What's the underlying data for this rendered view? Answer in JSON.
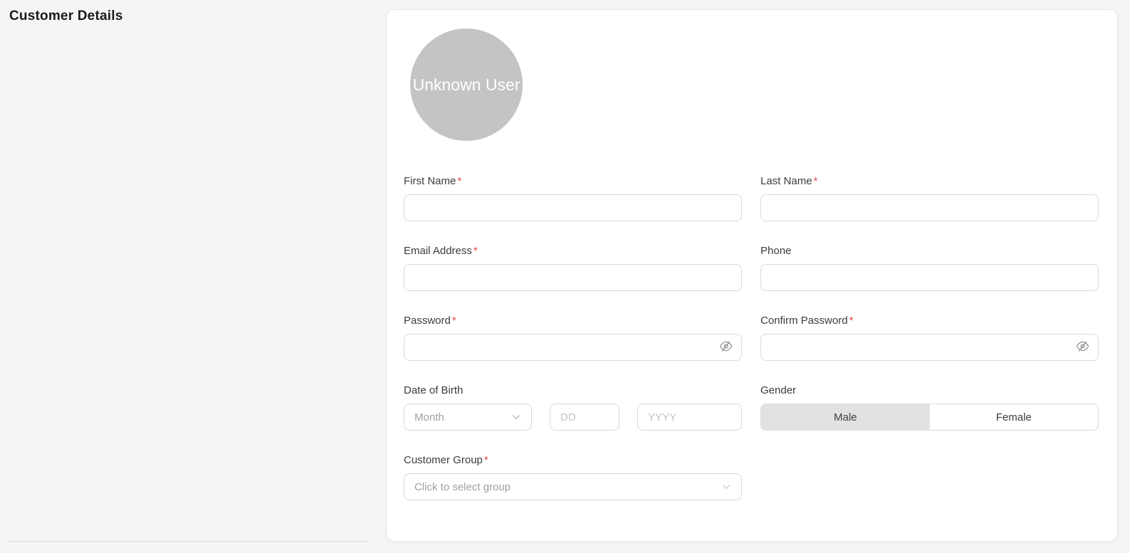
{
  "header": {
    "title": "Customer Details"
  },
  "avatar": {
    "text": "Unknown User"
  },
  "fields": {
    "first_name": {
      "label": "First Name",
      "required": "*",
      "value": "",
      "placeholder": ""
    },
    "last_name": {
      "label": "Last Name",
      "required": "*",
      "value": "",
      "placeholder": ""
    },
    "email": {
      "label": "Email Address",
      "required": "*",
      "value": "",
      "placeholder": ""
    },
    "phone": {
      "label": "Phone",
      "value": "",
      "placeholder": ""
    },
    "password": {
      "label": "Password",
      "required": "*",
      "value": "",
      "placeholder": ""
    },
    "confirm_password": {
      "label": "Confirm Password",
      "required": "*",
      "value": "",
      "placeholder": ""
    },
    "dob": {
      "label": "Date of Birth",
      "month_placeholder": "Month",
      "month_value": "",
      "day_placeholder": "DD",
      "day_value": "",
      "year_placeholder": "YYYY",
      "year_value": ""
    },
    "gender": {
      "label": "Gender",
      "options": [
        "Male",
        "Female"
      ],
      "selected": "Male"
    },
    "customer_group": {
      "label": "Customer Group",
      "required": "*",
      "placeholder": "Click to select group",
      "value": ""
    }
  },
  "icons": {
    "password_toggle": "eye-invisible-icon",
    "dropdown": "chevron-down-icon"
  },
  "colors": {
    "page_bg": "#f4f5f7",
    "card_bg": "#ffffff",
    "avatar_bg": "#c4c4c4",
    "required_mark": "#e5464b",
    "input_border": "#d9d9d9",
    "selected_gender_bg": "#e2e2e2",
    "label_text": "#3c3c3c",
    "placeholder_text": "#9aa1a8"
  }
}
